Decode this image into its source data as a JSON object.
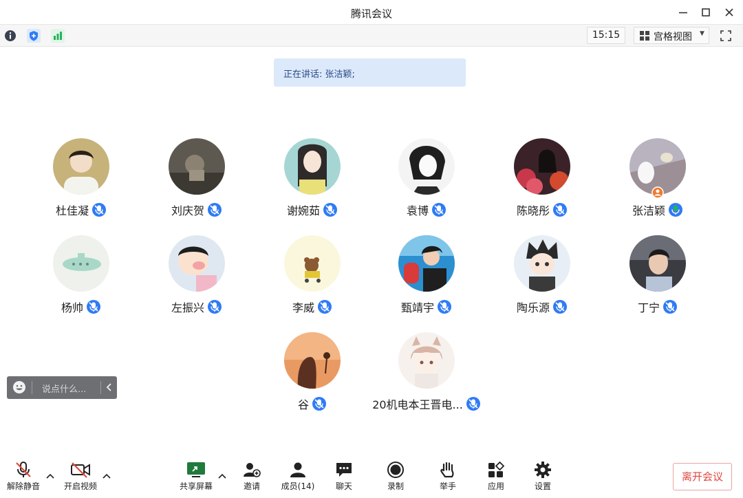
{
  "window": {
    "title": "腾讯会议",
    "clock": "15:15",
    "view_mode_label": "宫格视图"
  },
  "speaking_banner": "正在讲话: 张洁颖;",
  "participants": [
    {
      "name": "杜佳凝",
      "mic": "muted"
    },
    {
      "name": "刘庆贺",
      "mic": "muted"
    },
    {
      "name": "谢婉茹",
      "mic": "muted"
    },
    {
      "name": "袁博",
      "mic": "muted"
    },
    {
      "name": "陈晓彤",
      "mic": "muted"
    },
    {
      "name": "张洁颖",
      "mic": "active",
      "host_badge": true
    },
    {
      "name": "杨帅",
      "mic": "muted"
    },
    {
      "name": "左振兴",
      "mic": "muted"
    },
    {
      "name": "李威",
      "mic": "muted"
    },
    {
      "name": "甄靖宇",
      "mic": "muted"
    },
    {
      "name": "陶乐源",
      "mic": "muted"
    },
    {
      "name": "丁宁",
      "mic": "muted"
    },
    {
      "name": "谷",
      "mic": "muted"
    },
    {
      "name": "20机电本王晋电...",
      "mic": "muted"
    }
  ],
  "chat": {
    "placeholder": "说点什么..."
  },
  "toolbar": {
    "unmute": "解除静音",
    "start_video": "开启视频",
    "share_screen": "共享屏幕",
    "invite": "邀请",
    "members": "成员(14)",
    "chat": "聊天",
    "record": "录制",
    "raise_hand": "举手",
    "apps": "应用",
    "settings": "设置",
    "leave": "离开会议"
  },
  "colors": {
    "accent_blue": "#2f7bf5",
    "active_mic_green": "#24b35b",
    "leave_red": "#e0463c",
    "banner_bg": "#dce9fb"
  }
}
